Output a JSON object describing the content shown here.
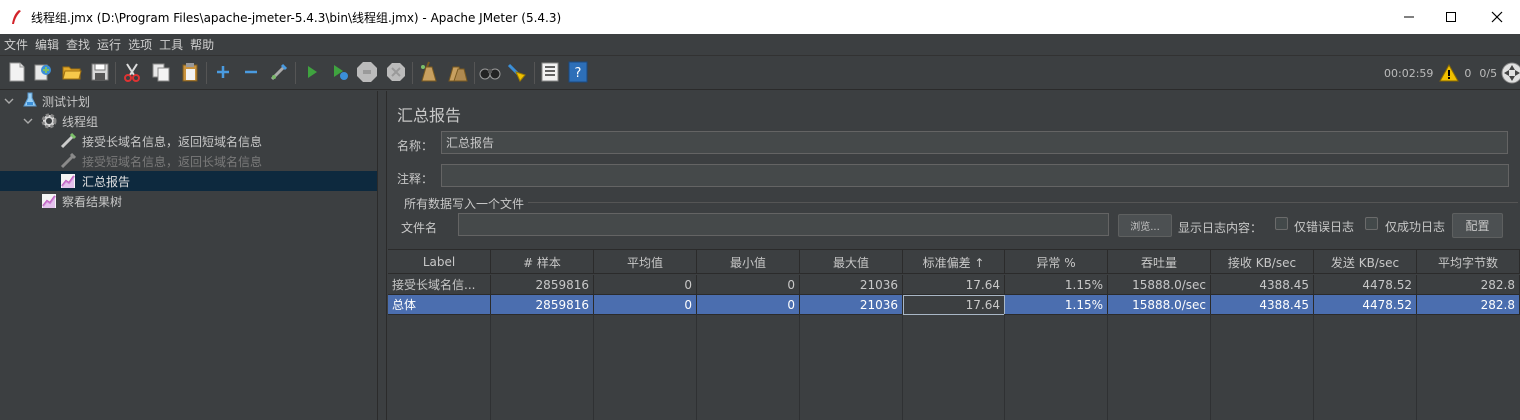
{
  "window": {
    "title": "线程组.jmx (D:\\Program Files\\apache-jmeter-5.4.3\\bin\\线程组.jmx) - Apache JMeter (5.4.3)",
    "controls": [
      "minimize-icon",
      "maximize-icon",
      "close-icon"
    ]
  },
  "menu": [
    "文件",
    "编辑",
    "查找",
    "运行",
    "选项",
    "工具",
    "帮助"
  ],
  "toolbar": {
    "icons": [
      "new-icon",
      "templates-icon",
      "open-icon",
      "save-icon",
      "cut-icon",
      "copy-icon",
      "paste-icon",
      "expand-icon",
      "collapse-icon",
      "toggle-icon",
      "start-icon",
      "start-no-pauses-icon",
      "stop-icon",
      "shutdown-icon",
      "clear-icon",
      "clear-all-icon",
      "search-icon",
      "reset-search-icon",
      "function-helper-icon",
      "help-icon"
    ],
    "elapsed_time": "00:02:59",
    "warning_count": "0",
    "threads": "0/5"
  },
  "tree": {
    "items": [
      {
        "label": "测试计划",
        "icon": "test-plan-icon"
      },
      {
        "label": "线程组",
        "icon": "thread-group-gear-icon"
      },
      {
        "label": "接受长域名信息，返回短域名信息",
        "icon": "http-sampler-icon"
      },
      {
        "label": "接受短域名信息，返回长域名信息",
        "icon": "http-sampler-icon",
        "disabled": true
      },
      {
        "label": "汇总报告",
        "icon": "report-chart-icon",
        "selected": true
      },
      {
        "label": "察看结果树",
        "icon": "report-chart-icon"
      }
    ]
  },
  "panel": {
    "title": "汇总报告",
    "name_label": "名称：",
    "name_value": "汇总报告",
    "comment_label": "注释：",
    "comment_value": "",
    "group_title": "所有数据写入一个文件",
    "file_label": "文件名",
    "file_value": "",
    "browse_button": "浏览...",
    "log_display_label": "显示日志内容：",
    "errors_only_label": "仅错误日志",
    "success_only_label": "仅成功日志",
    "configure_button": "配置"
  },
  "table": {
    "columns": [
      "Label",
      "# 样本",
      "平均值",
      "最小值",
      "最大值",
      "标准偏差 ↑",
      "异常 %",
      "吞吐量",
      "接收 KB/sec",
      "发送 KB/sec",
      "平均字节数"
    ],
    "rows": [
      [
        "接受长域名信...",
        "2859816",
        "0",
        "0",
        "21036",
        "17.64",
        "1.15%",
        "15888.0/sec",
        "4388.45",
        "4478.52",
        "282.8"
      ],
      [
        "总体",
        "2859816",
        "0",
        "0",
        "21036",
        "17.64",
        "1.15%",
        "15888.0/sec",
        "4388.45",
        "4478.52",
        "282.8"
      ]
    ],
    "selected_row": 1
  },
  "colors": {
    "background": "#3c3f41",
    "selection": "#4b6eaf",
    "tree_selection": "#0d293e",
    "accent_green": "#3fa33f",
    "warning": "#f0c000"
  }
}
